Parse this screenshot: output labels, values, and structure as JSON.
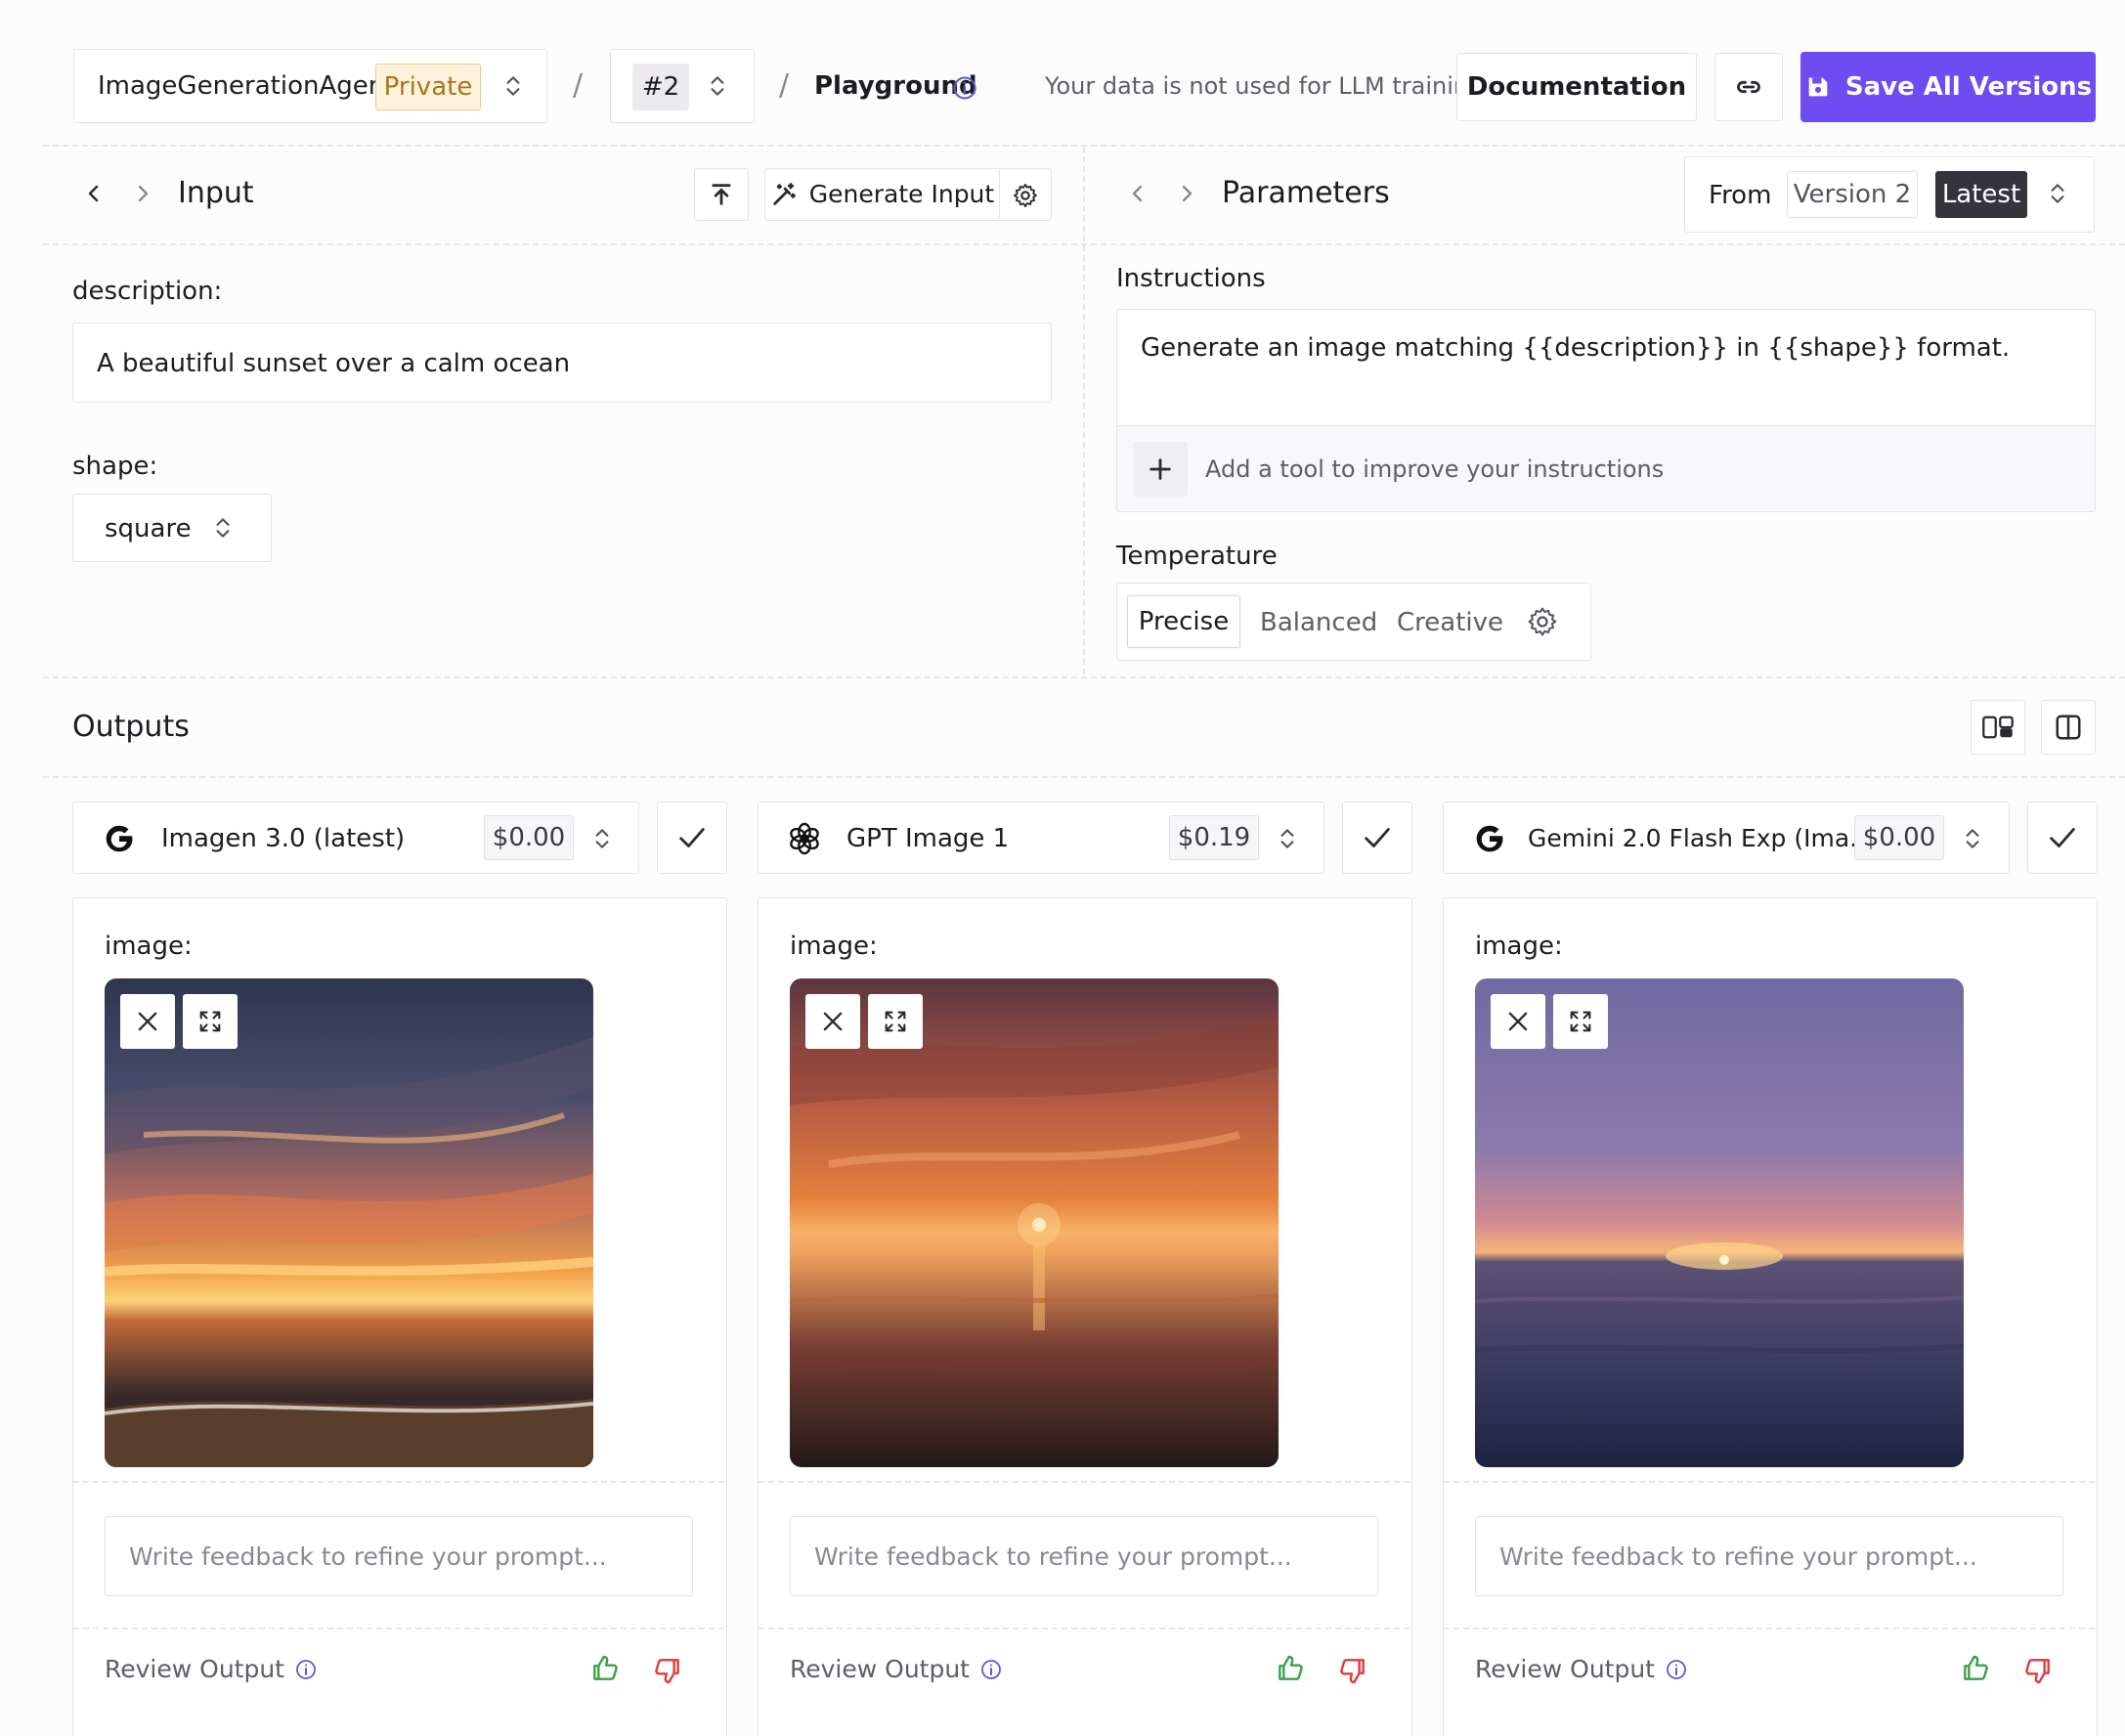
{
  "header": {
    "agent_name": "ImageGenerationAgent",
    "visibility_badge": "Private",
    "separator": "/",
    "version": "#2",
    "page": "Playground",
    "privacy_note": "Your data is not used for LLM training.",
    "documentation_label": "Documentation",
    "save_label": "Save All Versions",
    "accent_color": "#6d4cf2",
    "badge_color": "#fdf3dc"
  },
  "input_panel": {
    "title": "Input",
    "generate_label": "Generate Input",
    "fields": [
      {
        "label": "description:",
        "value": "A beautiful sunset over a calm ocean"
      },
      {
        "label": "shape:",
        "value": "square"
      }
    ]
  },
  "parameters_panel": {
    "title": "Parameters",
    "from_label": "From",
    "version_label": "Version 2",
    "latest_label": "Latest",
    "instructions_label": "Instructions",
    "instructions_text": "Generate an image matching {{description}} in {{shape}} format.",
    "add_tool_label": "Add a tool to improve your instructions",
    "temperature_label": "Temperature",
    "temperature_options": [
      "Precise",
      "Balanced",
      "Creative"
    ],
    "temperature_selected": "Precise"
  },
  "outputs": {
    "title": "Outputs",
    "image_label": "image:",
    "feedback_placeholder": "Write feedback to refine your prompt...",
    "review_label": "Review Output",
    "models": [
      {
        "name": "Imagen 3.0 (latest)",
        "price": "$0.00",
        "icon": "google-icon"
      },
      {
        "name": "GPT Image 1",
        "price": "$0.19",
        "icon": "openai-icon"
      },
      {
        "name": "Gemini 2.0 Flash Exp (Ima...",
        "price": "$0.00",
        "icon": "google-icon"
      }
    ],
    "thumbs_up_color": "#3aa14a",
    "thumbs_down_color": "#e03b3b"
  }
}
